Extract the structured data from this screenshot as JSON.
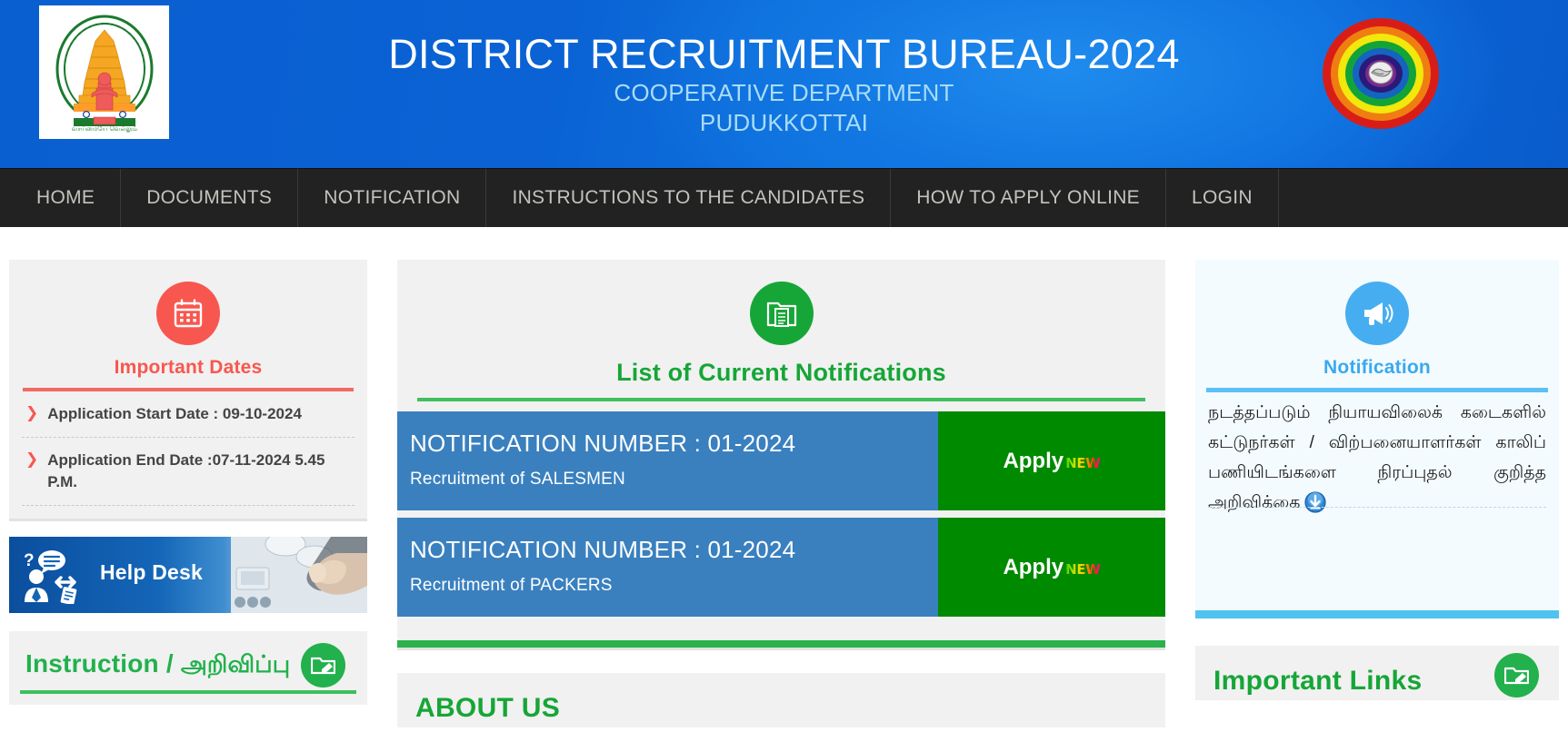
{
  "header": {
    "title": "DISTRICT RECRUITMENT BUREAU-2024",
    "subtitle_line1": "COOPERATIVE DEPARTMENT",
    "subtitle_line2": "PUDUKKOTTAI",
    "emblem_name": "tamil-nadu-government-emblem",
    "coop_logo_name": "cooperative-movement-rainbow-logo",
    "bg_color": "#0b63d6",
    "subtitle_color": "#a9dcf8"
  },
  "nav": {
    "items": [
      {
        "label": "HOME"
      },
      {
        "label": "DOCUMENTS"
      },
      {
        "label": "NOTIFICATION"
      },
      {
        "label": "INSTRUCTIONS TO THE CANDIDATES"
      },
      {
        "label": "HOW TO APPLY ONLINE"
      },
      {
        "label": "LOGIN"
      }
    ],
    "bg_color": "#222222",
    "text_color": "#c3c3bd"
  },
  "left": {
    "dates_card": {
      "icon": "calendar-icon",
      "title": "Important Dates",
      "accent_color": "#f8574f",
      "rows": [
        {
          "bullet": "❯",
          "text": "Application Start Date : 09-10-2024"
        },
        {
          "bullet": "❯",
          "text": "Application End Date :07-11-2024 5.45 P.M."
        }
      ]
    },
    "help_desk": {
      "label": "Help Desk",
      "icon": "help-desk-support-icon",
      "photo": "hand-touching-screen-photo"
    },
    "instruction_card": {
      "title_en": "Instruction / ",
      "title_ta": "அறிவிப்பு",
      "icon": "folder-edit-icon",
      "accent_color": "#22b14c"
    }
  },
  "mid": {
    "notifications_panel": {
      "icon": "documents-folder-icon",
      "title": "List of Current Notifications",
      "accent_color": "#16a637",
      "rows": [
        {
          "number": "NOTIFICATION NUMBER : 01-2024",
          "post": "Recruitment of SALESMEN",
          "apply_label": "Apply",
          "new_badge": "NEW"
        },
        {
          "number": "NOTIFICATION NUMBER : 01-2024",
          "post": "Recruitment of PACKERS",
          "apply_label": "Apply",
          "new_badge": "NEW"
        }
      ]
    },
    "about_card": {
      "title": "ABOUT US"
    }
  },
  "right": {
    "notice_panel": {
      "icon": "megaphone-icon",
      "title": "Notification",
      "accent_color": "#3aa9ef",
      "body": "நடத்தப்படும் நியாயவிலைக் கடைகளில் கட்டுநர்கள் / விற்பனையாளர்கள் காலிப் பணியிடங்களை நிரப்புதல் குறித்த அறிவிக்கை",
      "download_icon": "download-icon"
    },
    "links_card": {
      "title": "Important Links",
      "icon": "folder-edit-icon"
    }
  }
}
